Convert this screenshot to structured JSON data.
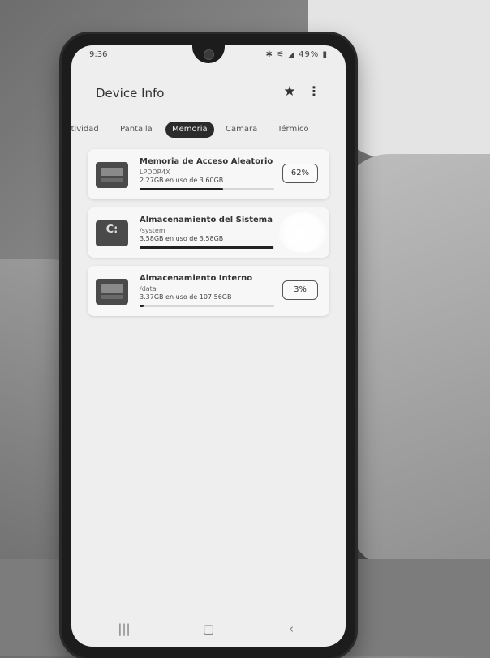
{
  "status": {
    "time": "9:36",
    "icons": "✱ ⚟ ◢ 49% ▮"
  },
  "app": {
    "title": "Device Info"
  },
  "icons": {
    "favorite": "star-icon",
    "more": "more-vert-icon",
    "recents": "recents-icon",
    "home": "home-icon",
    "back": "back-icon"
  },
  "tabs": [
    {
      "label": "ctividad",
      "active": false
    },
    {
      "label": "Pantalla",
      "active": false
    },
    {
      "label": "Memoria",
      "active": true
    },
    {
      "label": "Camara",
      "active": false
    },
    {
      "label": "Térmico",
      "active": false
    }
  ],
  "cards": [
    {
      "title": "Memoria de Acceso Aleatorio",
      "subtitle": "LPDDR4X",
      "usage": "2.27GB en uso de 3.60GB",
      "percent_label": "62%",
      "percent": 0.62
    },
    {
      "title": "Almacenamiento del Sistema",
      "subtitle": "/system",
      "usage": "3.58GB en uso de 3.58GB",
      "percent_label": "",
      "percent": 0.995,
      "icon_glyph": "C:"
    },
    {
      "title": "Almacenamiento Interno",
      "subtitle": "/data",
      "usage": "3.37GB en uso de 107.56GB",
      "percent_label": "3%",
      "percent": 0.03
    }
  ],
  "colors": {
    "screen_bg": "#eeeeee",
    "active_tab": "#2b2b2b",
    "progress": "#222222"
  }
}
